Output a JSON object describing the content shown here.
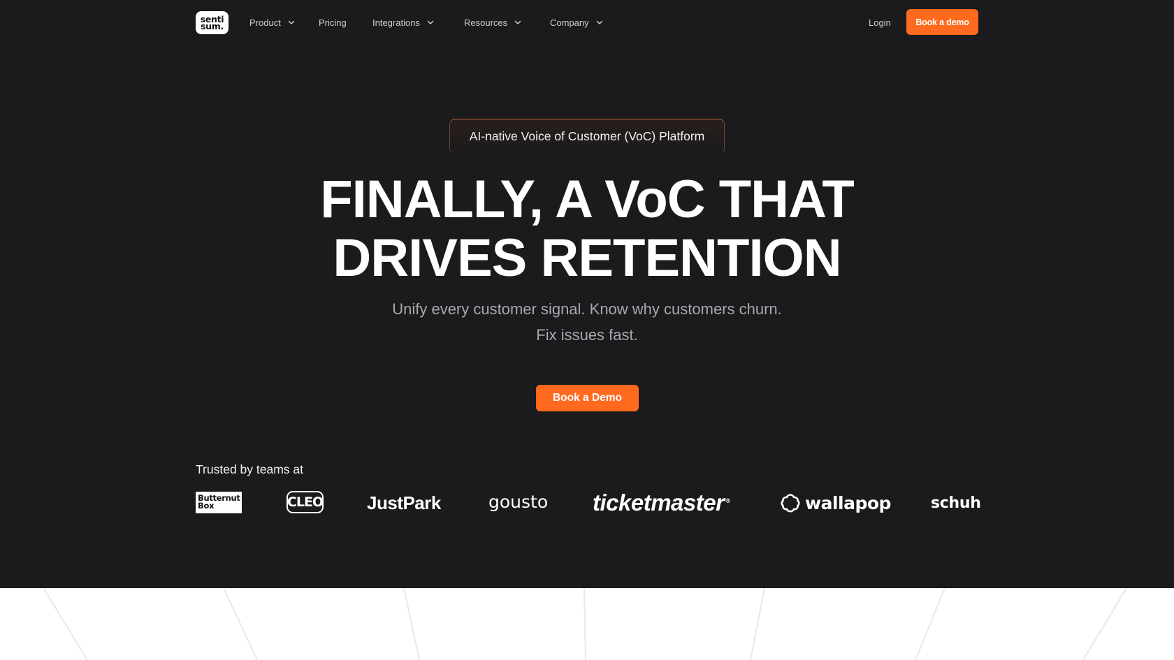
{
  "nav": {
    "logo_line1": "senti",
    "logo_line2": "sum.",
    "items": [
      {
        "label": "Product",
        "has_dropdown": true
      },
      {
        "label": "Pricing",
        "has_dropdown": false
      },
      {
        "label": "Integrations",
        "has_dropdown": true
      },
      {
        "label": "Resources",
        "has_dropdown": true
      },
      {
        "label": "Company",
        "has_dropdown": true
      }
    ],
    "login_label": "Login",
    "cta_label": "Book a demo"
  },
  "hero": {
    "badge": "AI-native Voice of Customer (VoC) Platform",
    "headline_line1": "FINALLY, A VoC THAT",
    "headline_line2": "DRIVES RETENTION",
    "sub_line1": "Unify every customer signal. Know why customers churn.",
    "sub_line2": "Fix issues fast.",
    "cta_label": "Book a Demo"
  },
  "trusted": {
    "label": "Trusted by teams at",
    "logos": {
      "butternut_line1": "Butternut",
      "butternut_line2": "Box",
      "cleo": "CLEO",
      "justpark": "JustPark",
      "gousto": "gousto",
      "ticketmaster": "ticketmaster",
      "ticketmaster_mark": "®",
      "wallapop": "wallapop",
      "schuh": "schuh"
    }
  },
  "colors": {
    "background": "#1b1a1c",
    "accent": "#ff6a1f",
    "text_primary": "#ffffff",
    "text_muted": "#a9a8ad",
    "nav_text": "#cfcfd2",
    "lower_section": "#ffffff"
  },
  "icons": {
    "dropdown": "chevron-down-icon",
    "wallapop": "wallapop-cloud-icon"
  }
}
